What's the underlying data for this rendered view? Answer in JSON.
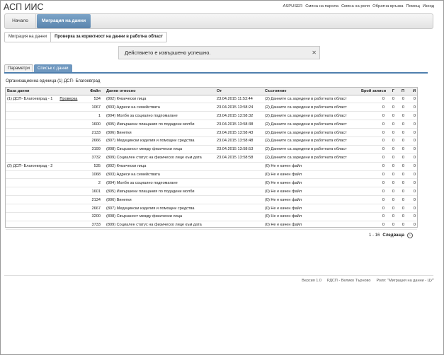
{
  "app": {
    "title": "АСП ИИС"
  },
  "toplinks": [
    "ASPUSER",
    "Смяна на парола",
    "Смяна на роля",
    "Обратна връзка",
    "Помощ",
    "Изход"
  ],
  "nav": {
    "start": "Начало",
    "active": "Миграция на данни"
  },
  "breadcrumb": {
    "first": "Миграция на данни",
    "current": "Проверка за коректност на данни в работна област"
  },
  "message": {
    "text": "Действието е извършено успешно.",
    "close": "✕"
  },
  "tabs": {
    "params": "Параметри",
    "list": "Списък с данни"
  },
  "org_unit": "Организационна единица (1) ДСП- Благоевград",
  "table": {
    "headers": {
      "db": "База данни",
      "file": "Файл",
      "data": "Данни относно",
      "from": "От",
      "state": "Състояние",
      "count": "Брой записи",
      "g": "Г",
      "p": "П",
      "i": "И"
    },
    "rows": [
      {
        "db": "(1) ДСП- Благоевград - 1",
        "link": "Проверка",
        "file": "534",
        "data": "(802) Физически лица",
        "from": "23.04.2015 11:53:44",
        "state": "(2) Данните са заредени в работната област",
        "count": "0",
        "g": "0",
        "p": "0",
        "i": "0"
      },
      {
        "db": "",
        "link": "",
        "file": "1067",
        "data": "(803) Адреси на семействата",
        "from": "23.04.2015 13:58:24",
        "state": "(2) Данните са заредени в работната област",
        "count": "0",
        "g": "0",
        "p": "0",
        "i": "0"
      },
      {
        "db": "",
        "link": "",
        "file": "1",
        "data": "(804) Молби за социално подпомагане",
        "from": "23.04.2015 13:58:32",
        "state": "(2) Данните са заредени в работната област",
        "count": "0",
        "g": "0",
        "p": "0",
        "i": "0"
      },
      {
        "db": "",
        "link": "",
        "file": "1600",
        "data": "(805) Извършени плащания по подадени молби",
        "from": "23.04.2015 13:58:38",
        "state": "(2) Данните са заредени в работната област",
        "count": "0",
        "g": "0",
        "p": "0",
        "i": "0"
      },
      {
        "db": "",
        "link": "",
        "file": "2133",
        "data": "(806) Винетки",
        "from": "23.04.2015 13:58:43",
        "state": "(2) Данните са заредени в работната област",
        "count": "0",
        "g": "0",
        "p": "0",
        "i": "0"
      },
      {
        "db": "",
        "link": "",
        "file": "2666",
        "data": "(807) Медицински изделия и помощни средства",
        "from": "23.04.2015 13:58:48",
        "state": "(2) Данните са заредени в работната област",
        "count": "0",
        "g": "0",
        "p": "0",
        "i": "0"
      },
      {
        "db": "",
        "link": "",
        "file": "3199",
        "data": "(808) Свързаност между физически лица",
        "from": "23.04.2015 13:58:53",
        "state": "(2) Данните са заредени в работната област",
        "count": "0",
        "g": "0",
        "p": "0",
        "i": "0"
      },
      {
        "db": "",
        "link": "",
        "file": "3732",
        "data": "(809) Социален статус на физическо лице към дата",
        "from": "23.04.2015 13:58:58",
        "state": "(2) Данните са заредени в работната област",
        "count": "0",
        "g": "0",
        "p": "0",
        "i": "0"
      },
      {
        "db": "(2) ДСП- Благоевград - 2",
        "link": "",
        "file": "535",
        "data": "(802) Физически лица",
        "from": "",
        "state": "(0) Не е качен файл",
        "count": "0",
        "g": "0",
        "p": "0",
        "i": "0"
      },
      {
        "db": "",
        "link": "",
        "file": "1068",
        "data": "(803) Адреси на семействата",
        "from": "",
        "state": "(0) Не е качен файл",
        "count": "0",
        "g": "0",
        "p": "0",
        "i": "0"
      },
      {
        "db": "",
        "link": "",
        "file": "2",
        "data": "(804) Молби за социално подпомагане",
        "from": "",
        "state": "(0) Не е качен файл",
        "count": "0",
        "g": "0",
        "p": "0",
        "i": "0"
      },
      {
        "db": "",
        "link": "",
        "file": "1601",
        "data": "(805) Извършени плащания по подадени молби",
        "from": "",
        "state": "(0) Не е качен файл",
        "count": "0",
        "g": "0",
        "p": "0",
        "i": "0"
      },
      {
        "db": "",
        "link": "",
        "file": "2134",
        "data": "(806) Винетки",
        "from": "",
        "state": "(0) Не е качен файл",
        "count": "0",
        "g": "0",
        "p": "0",
        "i": "0"
      },
      {
        "db": "",
        "link": "",
        "file": "2667",
        "data": "(807) Медицински изделия и помощни средства",
        "from": "",
        "state": "(0) Не е качен файл",
        "count": "0",
        "g": "0",
        "p": "0",
        "i": "0"
      },
      {
        "db": "",
        "link": "",
        "file": "3200",
        "data": "(808) Свързаност между физически лица",
        "from": "",
        "state": "(0) Не е качен файл",
        "count": "0",
        "g": "0",
        "p": "0",
        "i": "0"
      },
      {
        "db": "",
        "link": "",
        "file": "3733",
        "data": "(809) Социален статус на физическо лице към дата",
        "from": "",
        "state": "(0) Не е качен файл",
        "count": "0",
        "g": "0",
        "p": "0",
        "i": "0"
      }
    ]
  },
  "pager": {
    "range": "1 - 16",
    "next": "Следваща",
    "arrow": "›"
  },
  "footer": [
    "Версия 1.0",
    "РДСП - Велико Търново",
    "Роля: \"Миграция на данни - ЦУ\""
  ]
}
